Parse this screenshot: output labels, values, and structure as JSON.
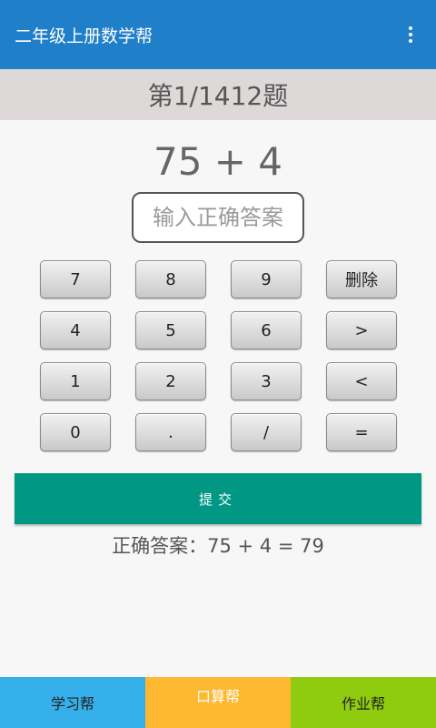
{
  "appbar": {
    "title": "二年级上册数学帮",
    "menu_icon": "more-vert-icon"
  },
  "progress": {
    "text": "第1/1412题"
  },
  "question": {
    "expression": "75 + 4"
  },
  "answer": {
    "value": "",
    "placeholder": "输入正确答案"
  },
  "keypad": {
    "keys": [
      "7",
      "8",
      "9",
      "删除",
      "4",
      "5",
      "6",
      ">",
      "1",
      "2",
      "3",
      "<",
      "0",
      ".",
      "/",
      "="
    ]
  },
  "submit": {
    "label": "提交"
  },
  "result": {
    "text": "正确答案：75 + 4 = 79"
  },
  "bottom_nav": {
    "items": [
      {
        "label": "学习帮",
        "color": "#35b0ea"
      },
      {
        "label": "口算帮",
        "color": "#ffb831"
      },
      {
        "label": "作业帮",
        "color": "#8fcc0f"
      }
    ]
  },
  "colors": {
    "appbar": "#1f7fc8",
    "progress_bg": "#ddd9d8",
    "submit": "#009784"
  }
}
